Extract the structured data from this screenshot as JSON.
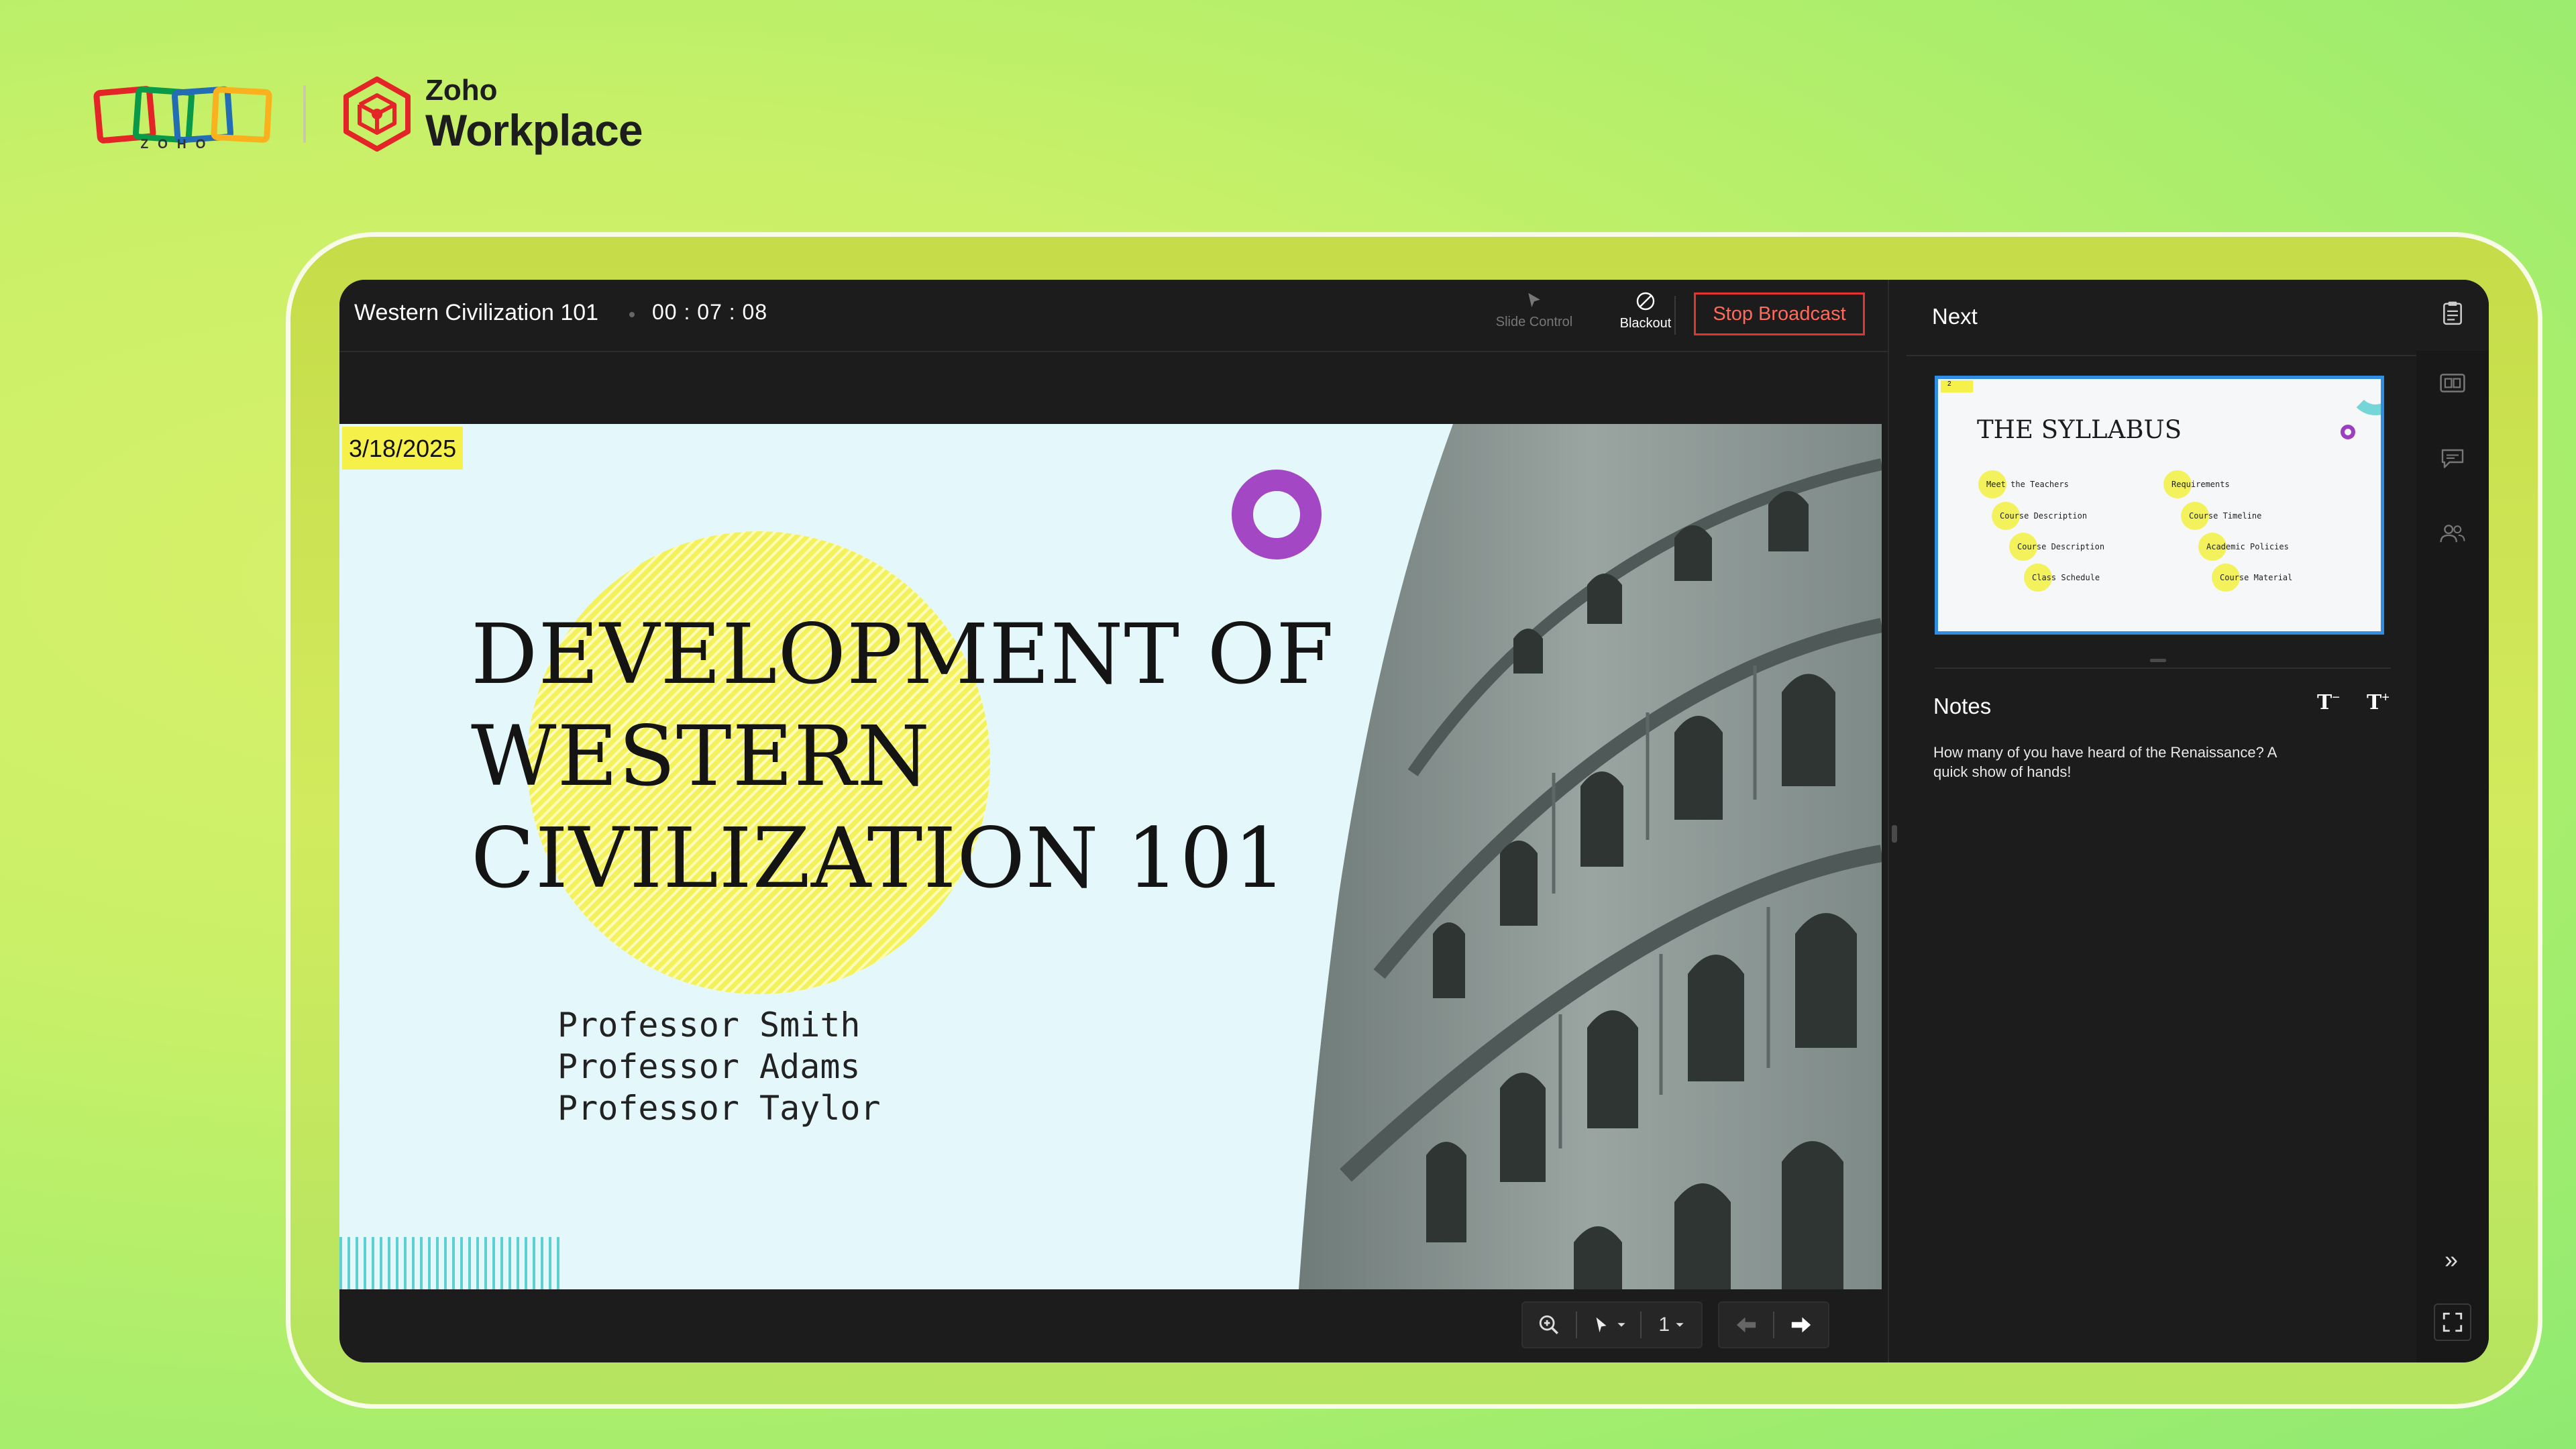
{
  "brand": {
    "zoho_word": "ZOHO",
    "product_small": "Zoho",
    "product_big": "Workplace",
    "colors": {
      "red": "#e42527",
      "green": "#089949",
      "blue": "#226db4",
      "yellow": "#f9b21d"
    }
  },
  "header": {
    "deck_title": "Western Civilization 101",
    "timer": "00 : 07 : 08",
    "slide_control_label": "Slide Control",
    "blackout_label": "Blackout",
    "stop_broadcast_label": "Stop Broadcast"
  },
  "slide": {
    "date": "3/18/2025",
    "title": "DEVELOPMENT OF WESTERN CIVILIZATION 101",
    "professors": [
      "Professor Smith",
      "Professor Adams",
      "Professor Taylor"
    ]
  },
  "controls": {
    "zoom_icon": "zoom-in-icon",
    "pointer_icon": "pointer-icon",
    "page_number": "1",
    "prev_icon": "arrow-left-icon",
    "next_icon": "arrow-right-icon"
  },
  "panel": {
    "next_label": "Next",
    "next_slide": {
      "number": "2",
      "title": "THE SYLLABUS",
      "items": [
        "Meet the Teachers",
        "Course Description",
        "Course Description",
        "Class Schedule",
        "Requirements",
        "Course Timeline",
        "Academic Policies",
        "Course Material"
      ]
    },
    "notes_label": "Notes",
    "font_smaller": "T",
    "font_smaller_sup": "−",
    "font_larger": "T",
    "font_larger_sup": "+",
    "notes_text": "How many of you have heard of the Renaissance? A quick show of hands!"
  },
  "rail": {
    "icons": [
      "notes-icon",
      "slides-icon",
      "chat-icon",
      "participants-icon"
    ],
    "expand_symbol": "»"
  },
  "accent_colors": {
    "stop": "#e0362f",
    "thumb_border": "#2f8de4",
    "highlight": "#f6f04a",
    "ring": "#a347c4"
  }
}
